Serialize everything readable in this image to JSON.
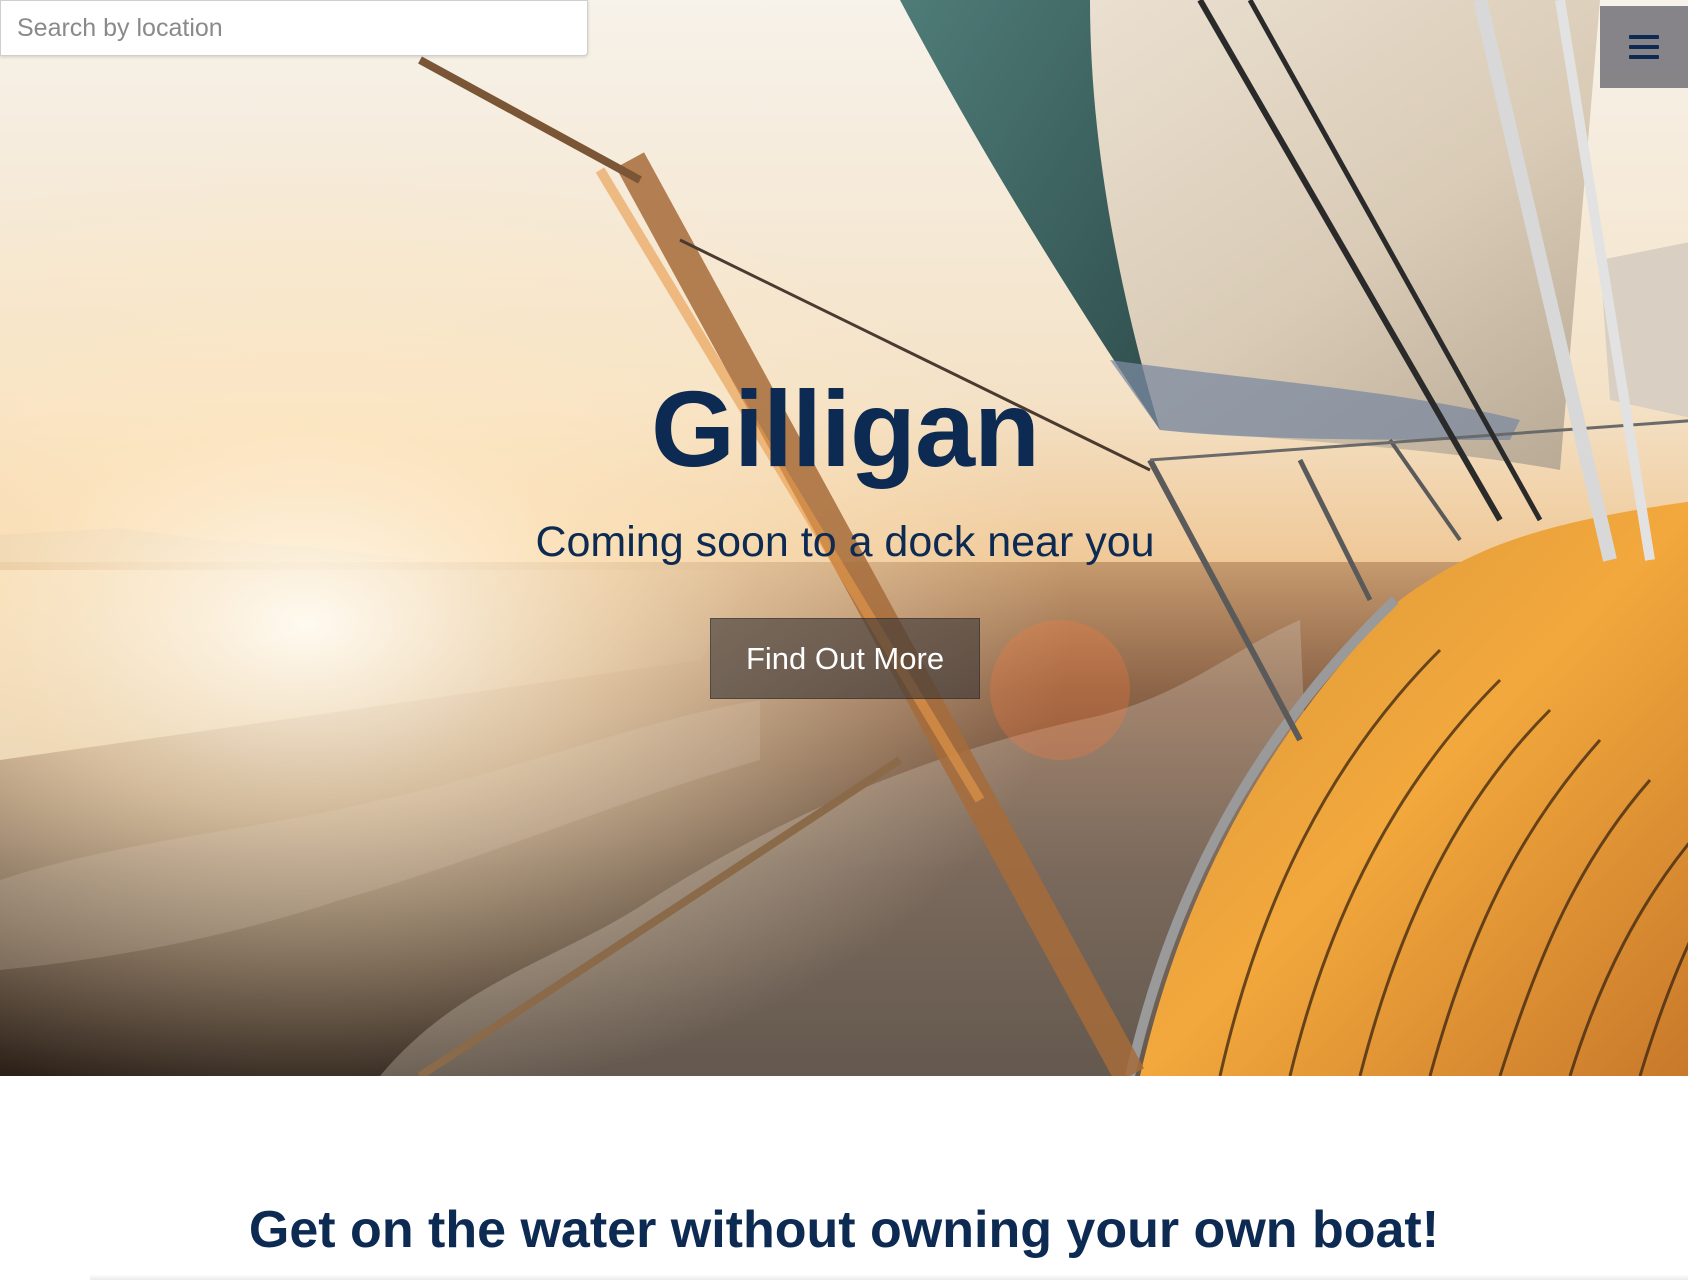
{
  "search": {
    "placeholder": "Search by location"
  },
  "menu": {
    "icon": "hamburger-menu-icon"
  },
  "hero": {
    "title": "Gilligan",
    "subtitle": "Coming soon to a dock near you",
    "cta_label": "Find Out More"
  },
  "lower": {
    "heading": "Get on the water without owning your own boat!"
  },
  "colors": {
    "brand_navy": "#0c2a52",
    "cta_bg": "#3c3737",
    "menu_bg": "#5a5a64"
  }
}
